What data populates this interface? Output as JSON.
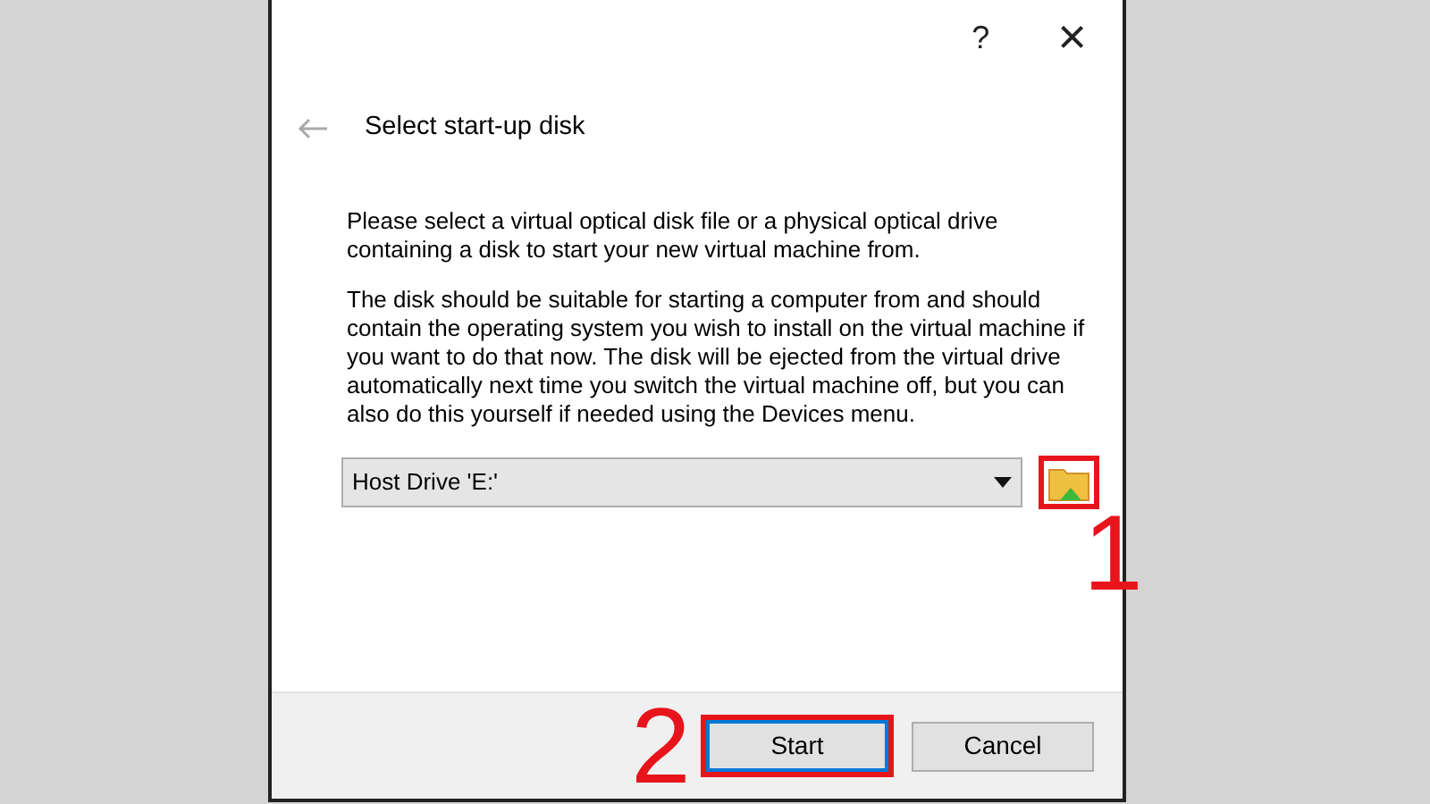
{
  "window": {
    "help": "?",
    "close": "×"
  },
  "title": "Select start-up disk",
  "paragraphs": [
    "Please select a virtual optical disk file or a physical optical drive containing a disk to start your new virtual machine from.",
    "The disk should be suitable for starting a computer from and should contain the operating system you wish to install on the virtual machine if you want to do that now. The disk will be ejected from the virtual drive automatically next time you switch the virtual machine off, but you can also do this yourself if needed using the Devices menu."
  ],
  "drive_select": {
    "value": "Host Drive 'E:'"
  },
  "buttons": [
    {
      "label": "Start",
      "default": true
    },
    {
      "label": "Cancel",
      "default": false
    }
  ],
  "annotations": [
    "1",
    "2"
  ]
}
